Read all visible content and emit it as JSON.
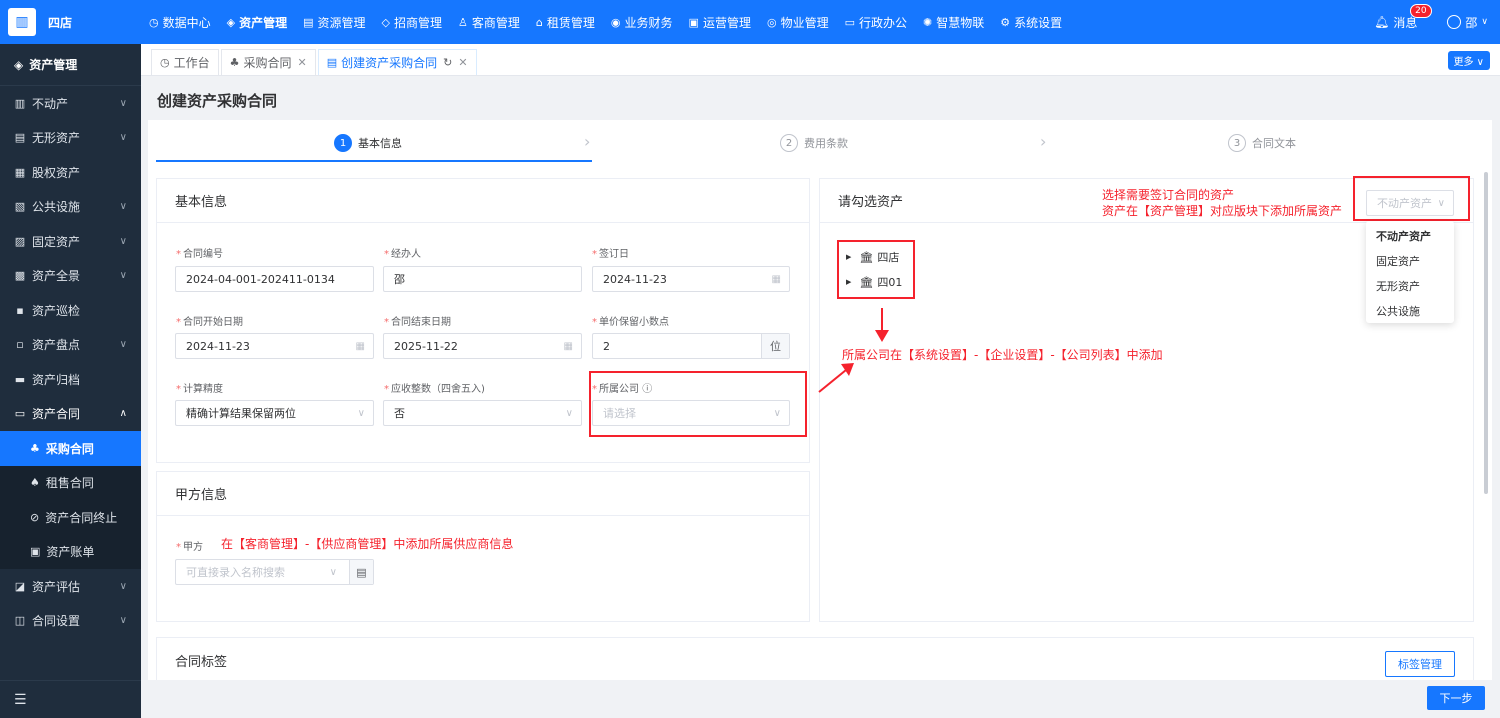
{
  "app": {
    "logo_text": "四店",
    "logo_icon": "building-icon"
  },
  "nav": [
    {
      "label": "数据中心",
      "icon": "◷"
    },
    {
      "label": "资产管理",
      "icon": "◈"
    },
    {
      "label": "资源管理",
      "icon": "▤"
    },
    {
      "label": "招商管理",
      "icon": "◇"
    },
    {
      "label": "客商管理",
      "icon": "♙"
    },
    {
      "label": "租赁管理",
      "icon": "⌂"
    },
    {
      "label": "业务财务",
      "icon": "◉"
    },
    {
      "label": "运营管理",
      "icon": "▣"
    },
    {
      "label": "物业管理",
      "icon": "◎"
    },
    {
      "label": "行政办公",
      "icon": "▭"
    },
    {
      "label": "智慧物联",
      "icon": "✺"
    },
    {
      "label": "系统设置",
      "icon": "⚙"
    }
  ],
  "top_right": {
    "messages_label": "消息",
    "messages_count": "20",
    "user_name": "邵"
  },
  "sidebar": {
    "title": "资产管理",
    "items": [
      {
        "label": "不动产",
        "icon": "▥"
      },
      {
        "label": "无形资产",
        "icon": "▤"
      },
      {
        "label": "股权资产",
        "icon": "▦"
      },
      {
        "label": "公共设施",
        "icon": "▧"
      },
      {
        "label": "固定资产",
        "icon": "▨"
      },
      {
        "label": "资产全景",
        "icon": "▩"
      },
      {
        "label": "资产巡检",
        "icon": "▪"
      },
      {
        "label": "资产盘点",
        "icon": "▫"
      },
      {
        "label": "资产归档",
        "icon": "▬"
      },
      {
        "label": "资产合同",
        "icon": "▭"
      }
    ],
    "sub_items": [
      {
        "label": "采购合同",
        "icon": "♣"
      },
      {
        "label": "租售合同",
        "icon": "♠"
      },
      {
        "label": "资产合同终止",
        "icon": "⊘"
      },
      {
        "label": "资产账单",
        "icon": "▣"
      }
    ],
    "items_after": [
      {
        "label": "资产评估",
        "icon": "◪"
      },
      {
        "label": "合同设置",
        "icon": "◫"
      }
    ]
  },
  "tabs": [
    {
      "label": "工作台",
      "icon": "◷"
    },
    {
      "label": "采购合同",
      "icon": "♣"
    },
    {
      "label": "创建资产采购合同",
      "icon": "▤"
    }
  ],
  "more_label": "更多",
  "page_title": "创建资产采购合同",
  "steps": [
    {
      "num": "1",
      "label": "基本信息"
    },
    {
      "num": "2",
      "label": "费用条款"
    },
    {
      "num": "3",
      "label": "合同文本"
    }
  ],
  "basic": {
    "title": "基本信息",
    "contract_no_label": "合同编号",
    "contract_no": "2024-04-001-202411-0134",
    "handler_label": "经办人",
    "handler": "邵",
    "sign_date_label": "签订日",
    "sign_date": "2024-11-23",
    "start_label": "合同开始日期",
    "start": "2024-11-23",
    "end_label": "合同结束日期",
    "end": "2025-11-22",
    "decimal_label": "单价保留小数点",
    "decimal": "2",
    "decimal_unit": "位",
    "precision_label": "计算精度",
    "precision": "精确计算结果保留两位",
    "round_label": "应收整数（四舍五入)",
    "round": "否",
    "company_label": "所属公司",
    "company_placeholder": "请选择"
  },
  "party": {
    "title": "甲方信息",
    "party_label": "甲方",
    "party_placeholder": "可直接录入名称搜索"
  },
  "asset_panel": {
    "title": "请勾选资产",
    "type_select": "不动产资产",
    "tree": [
      "四店",
      "四01"
    ],
    "dropdown": [
      "不动产资产",
      "固定资产",
      "无形资产",
      "公共设施"
    ]
  },
  "tags": {
    "title": "合同标签",
    "manage_label": "标签管理"
  },
  "next_label": "下一步",
  "annotations": {
    "asset_line1": "选择需要签订合同的资产",
    "asset_line2": "资产在【资产管理】对应版块下添加所属资产",
    "company_note": "所属公司在【系统设置】-【企业设置】-【公司列表】中添加",
    "supplier_note": "在【客商管理】-【供应商管理】中添加所属供应商信息"
  },
  "colors": {
    "primary": "#1677ff",
    "sidebar": "#1f2d3d",
    "annotation": "#f5222d"
  }
}
